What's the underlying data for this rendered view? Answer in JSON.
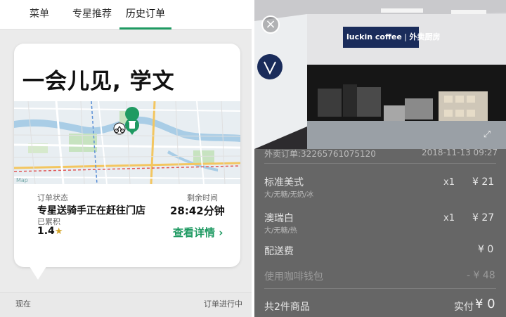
{
  "left": {
    "tabs": [
      {
        "label": "菜单"
      },
      {
        "label": "专星推荐"
      },
      {
        "label": "历史订单"
      }
    ],
    "greeting": "一会儿见, 学文",
    "order_status": {
      "label": "订单状态",
      "value": "专星送骑手正在赶往门店"
    },
    "remaining_time": {
      "label": "剩余时间",
      "value": "28:42分钟"
    },
    "accumulated": {
      "label": "已累积",
      "value": "1.4",
      "icon": "star-icon"
    },
    "detail_link": "查看详情",
    "map_brand": "Map",
    "footer": {
      "left": "现在",
      "right": "订单进行中"
    },
    "accent_color": "#1f9a62"
  },
  "right": {
    "store_sign": {
      "brand": "luckin coffee",
      "sub": "外卖厨房"
    },
    "order_id": "外卖订单:32265761075120",
    "order_date": "2018-11-13 09:27",
    "items": [
      {
        "name": "标准美式",
        "options": "大/无糖/无奶/冰",
        "qty": "x1",
        "price": "¥ 21"
      },
      {
        "name": "澳瑞白",
        "options": "大/无糖/热",
        "qty": "x1",
        "price": "¥ 27"
      }
    ],
    "delivery_fee": {
      "label": "配送费",
      "value": "¥ 0"
    },
    "wallet": {
      "label": "使用咖啡钱包",
      "value": "- ¥ 48"
    },
    "total": {
      "count_label": "共2件商品",
      "paid_label": "实付",
      "paid_value": "¥ 0"
    }
  }
}
